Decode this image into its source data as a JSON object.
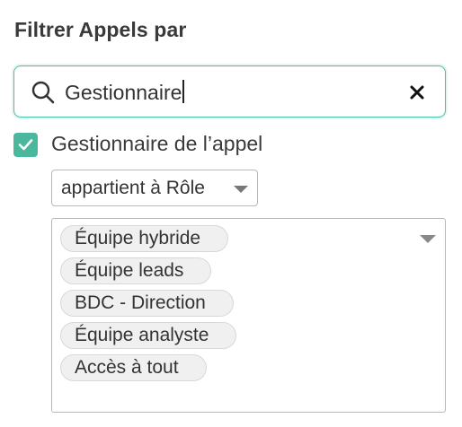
{
  "header": {
    "title": "Filtrer Appels par"
  },
  "search": {
    "value": "Gestionnaire",
    "icon": "search-icon",
    "clear_icon": "close-icon",
    "accent_color": "#4bbfa6"
  },
  "filter": {
    "checked": true,
    "label": "Gestionnaire de l’appel",
    "checkbox_color": "#4bb89e",
    "operator": "appartient à Rôle",
    "values": [
      "Équipe hybride",
      "Équipe leads",
      "BDC - Direction",
      "Équipe analyste",
      "Accès à tout"
    ]
  }
}
